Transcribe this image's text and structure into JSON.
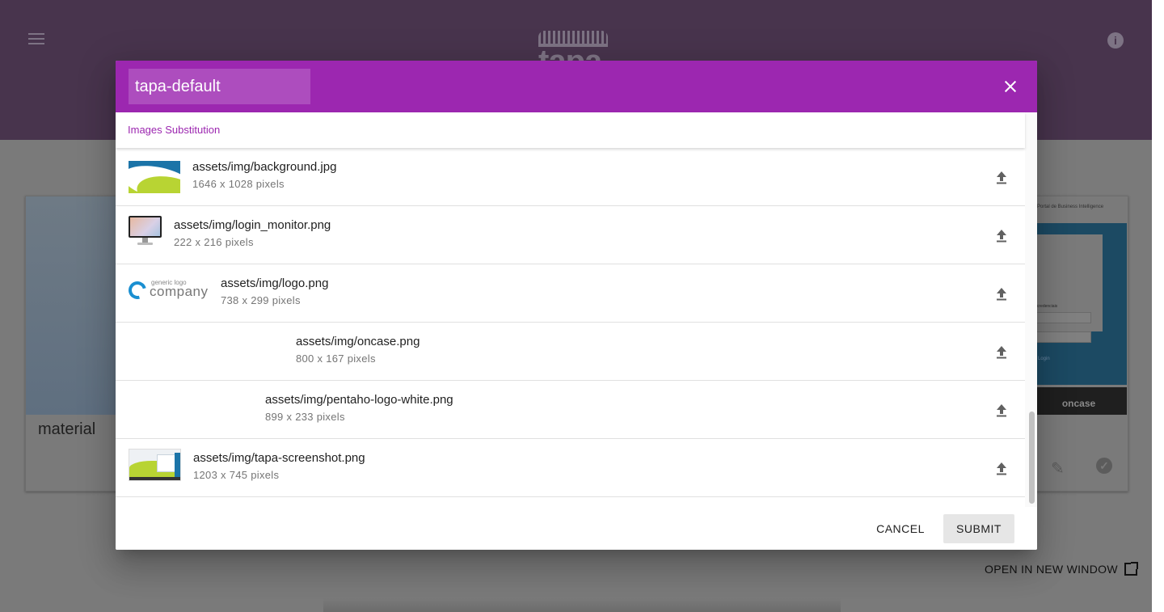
{
  "app": {
    "brand": "tapa",
    "card_title": "material",
    "open_new_window_label": "OPEN IN NEW WINDOW",
    "preview_header_text": "Portal de Business Intelligence",
    "preview_field_label": "s credenciais",
    "preview_login_label": "Login",
    "preview_footer_text": "oncase"
  },
  "dialog": {
    "name_value": "tapa-default",
    "tab_label": "Images Substitution",
    "cancel_label": "CANCEL",
    "submit_label": "SUBMIT",
    "accent_color": "#9c27b0",
    "images": [
      {
        "thumb": "background-thumbnail",
        "name": "assets/img/background.jpg",
        "size": "1646 x 1028 pixels"
      },
      {
        "thumb": "monitor-thumbnail",
        "name": "assets/img/login_monitor.png",
        "size": "222 x 216 pixels"
      },
      {
        "thumb": "company-logo-thumbnail",
        "name": "assets/img/logo.png",
        "size": "738 x 299 pixels",
        "logo_small": "generic logo",
        "logo_big": "company"
      },
      {
        "thumb": "oncase-thumbnail-white",
        "name": "assets/img/oncase.png",
        "size": "800 x 167 pixels"
      },
      {
        "thumb": "pentaho-thumbnail-white",
        "name": "assets/img/pentaho-logo-white.png",
        "size": "899 x 233 pixels"
      },
      {
        "thumb": "screenshot-thumbnail",
        "name": "assets/img/tapa-screenshot.png",
        "size": "1203 x 745 pixels"
      }
    ]
  },
  "icons": {
    "menu": "menu-icon",
    "info": "info-icon",
    "close": "close-icon",
    "upload": "upload-icon",
    "edit": "pencil-icon",
    "check": "check-circle-icon",
    "external": "open-in-new-icon"
  }
}
